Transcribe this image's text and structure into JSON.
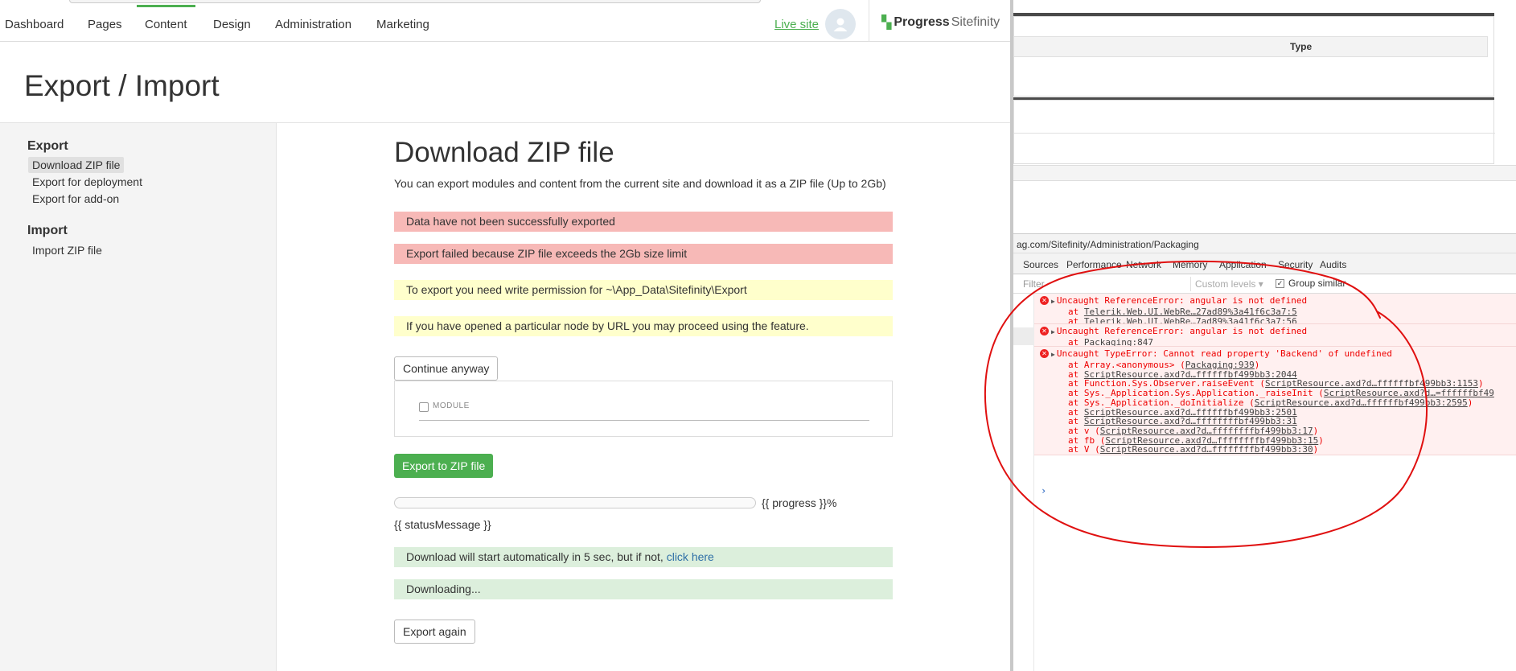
{
  "nav": {
    "items": [
      "Dashboard",
      "Pages",
      "Content",
      "Design",
      "Administration",
      "Marketing"
    ],
    "live_site": "Live site",
    "brand_progress": "Progress",
    "brand_sitefinity": "Sitefinity"
  },
  "page": {
    "title": "Export / Import"
  },
  "sidebar": {
    "export_heading": "Export",
    "export_items": [
      "Download ZIP file",
      "Export for deployment",
      "Export for add-on"
    ],
    "import_heading": "Import",
    "import_items": [
      "Import ZIP file"
    ]
  },
  "main": {
    "heading": "Download ZIP file",
    "intro": "You can export modules and content from the current site and download it as a ZIP file (Up to 2Gb)",
    "error1": "Data have not been successfully exported",
    "error2": "Export failed because ZIP file exceeds the 2Gb size limit",
    "warn1": "To export you need write permission for ~\\App_Data\\Sitefinity\\Export",
    "warn2": "If you have opened a particular node by URL you may proceed using the feature.",
    "continue_button": "Continue anyway",
    "module_label": "MODULE",
    "export_button": "Export to ZIP file",
    "progress_text": "{{ progress }}%",
    "progress_value": 0,
    "status_message": "{{ statusMessage }}",
    "download_text": "Download will start automatically in 5 sec, but if not, ",
    "download_link": "click here",
    "downloading": "Downloading...",
    "export_again_button": "Export again"
  },
  "background_window": {
    "table_header": "Type"
  },
  "devtools": {
    "url": "ag.com/Sitefinity/Administration/Packaging",
    "tabs": [
      "Sources",
      "Performance",
      "Network",
      "Memory",
      "Application",
      "Security",
      "Audits"
    ],
    "filter_placeholder": "Filter",
    "levels": "Custom levels ▾",
    "group_similar": "Group similar",
    "errors": [
      {
        "message": "Uncaught ReferenceError: angular is not defined",
        "frames": [
          {
            "prefix": "at ",
            "loc": "Telerik.Web.UI.WebRe…27ad89%3a41f6c3a7:5"
          },
          {
            "prefix": "at ",
            "loc": "Telerik.Web.UI.WebRe…7ad89%3a41f6c3a7:56"
          }
        ]
      },
      {
        "message": "Uncaught ReferenceError: angular is not defined",
        "frames": [
          {
            "prefix": "at ",
            "loc": "Packaging:847"
          }
        ]
      },
      {
        "message": "Uncaught TypeError: Cannot read property 'Backend' of undefined",
        "frames": [
          {
            "prefix": "at Array.<anonymous> (",
            "loc": "Packaging:939",
            "suffix": ")"
          },
          {
            "prefix": "at ",
            "loc": "ScriptResource.axd?d…ffffffbf499bb3:2044"
          },
          {
            "prefix": "at Function.Sys.Observer.raiseEvent (",
            "loc": "ScriptResource.axd?d…ffffffbf499bb3:1153",
            "suffix": ")"
          },
          {
            "prefix": "at Sys._Application.Sys.Application._raiseInit (",
            "loc": "ScriptResource.axd?d…=ffffffbf49",
            "suffix": ""
          },
          {
            "prefix": "at Sys._Application._doInitialize (",
            "loc": "ScriptResource.axd?d…ffffffbf499bb3:2595",
            "suffix": ")"
          },
          {
            "prefix": "at ",
            "loc": "ScriptResource.axd?d…ffffffbf499bb3:2501"
          },
          {
            "prefix": "at ",
            "loc": "ScriptResource.axd?d…ffffffffbf499bb3:31"
          },
          {
            "prefix": "at v (",
            "loc": "ScriptResource.axd?d…ffffffffbf499bb3:17",
            "suffix": ")"
          },
          {
            "prefix": "at fb (",
            "loc": "ScriptResource.axd?d…ffffffffbf499bb3:15",
            "suffix": ")"
          },
          {
            "prefix": "at V (",
            "loc": "ScriptResource.axd?d…ffffffffbf499bb3:30",
            "suffix": ")"
          }
        ]
      }
    ],
    "prompt": "›"
  },
  "colors": {
    "accent_green": "#4caf50",
    "error_bg": "#f7b9b7",
    "warning_bg": "#ffffcc",
    "success_bg": "#dcefdc",
    "console_error": "#e00000",
    "annotation_red": "#e01010"
  }
}
